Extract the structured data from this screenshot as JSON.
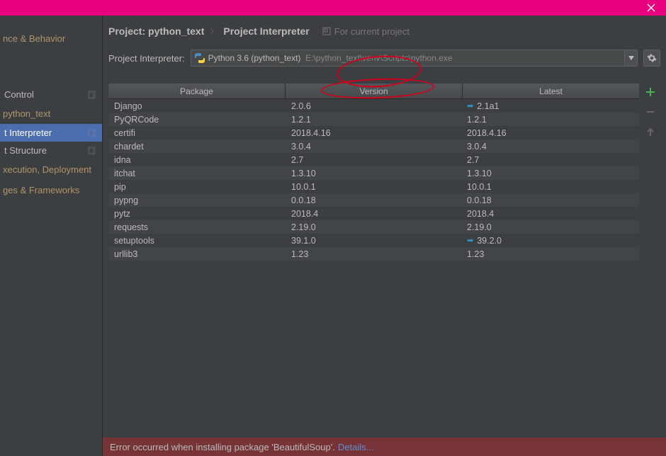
{
  "breadcrumb": {
    "root": "Project: python_text",
    "leaf": "Project Interpreter",
    "for_current": "For current project"
  },
  "interpreter": {
    "label": "Project Interpreter:",
    "selected_name": "Python 3.6 (python_text)",
    "selected_path": "E:\\python_text\\venv\\Scripts\\python.exe"
  },
  "sidebar": {
    "items": [
      {
        "label": "nce & Behavior",
        "type": "label"
      },
      {
        "label": "Control",
        "type": "item",
        "copy": true
      },
      {
        "label": "python_text",
        "type": "header"
      },
      {
        "label": "t Interpreter",
        "type": "item",
        "selected": true,
        "copy": true
      },
      {
        "label": "t Structure",
        "type": "item",
        "copy": true
      },
      {
        "label": "xecution, Deployment",
        "type": "label"
      },
      {
        "label": "ges & Frameworks",
        "type": "label"
      }
    ]
  },
  "table": {
    "headers": [
      "Package",
      "Version",
      "Latest"
    ],
    "rows": [
      {
        "pkg": "Django",
        "ver": "2.0.6",
        "latest": "2.1a1",
        "upgrade": true
      },
      {
        "pkg": "PyQRCode",
        "ver": "1.2.1",
        "latest": "1.2.1"
      },
      {
        "pkg": "certifi",
        "ver": "2018.4.16",
        "latest": "2018.4.16"
      },
      {
        "pkg": "chardet",
        "ver": "3.0.4",
        "latest": "3.0.4"
      },
      {
        "pkg": "idna",
        "ver": "2.7",
        "latest": "2.7"
      },
      {
        "pkg": "itchat",
        "ver": "1.3.10",
        "latest": "1.3.10"
      },
      {
        "pkg": "pip",
        "ver": "10.0.1",
        "latest": "10.0.1"
      },
      {
        "pkg": "pypng",
        "ver": "0.0.18",
        "latest": "0.0.18"
      },
      {
        "pkg": "pytz",
        "ver": "2018.4",
        "latest": "2018.4"
      },
      {
        "pkg": "requests",
        "ver": "2.19.0",
        "latest": "2.19.0"
      },
      {
        "pkg": "setuptools",
        "ver": "39.1.0",
        "latest": "39.2.0",
        "upgrade": true
      },
      {
        "pkg": "urllib3",
        "ver": "1.23",
        "latest": "1.23"
      }
    ]
  },
  "status": {
    "error": "Error occurred when installing package 'BeautifulSoup'.",
    "link": "Details..."
  }
}
